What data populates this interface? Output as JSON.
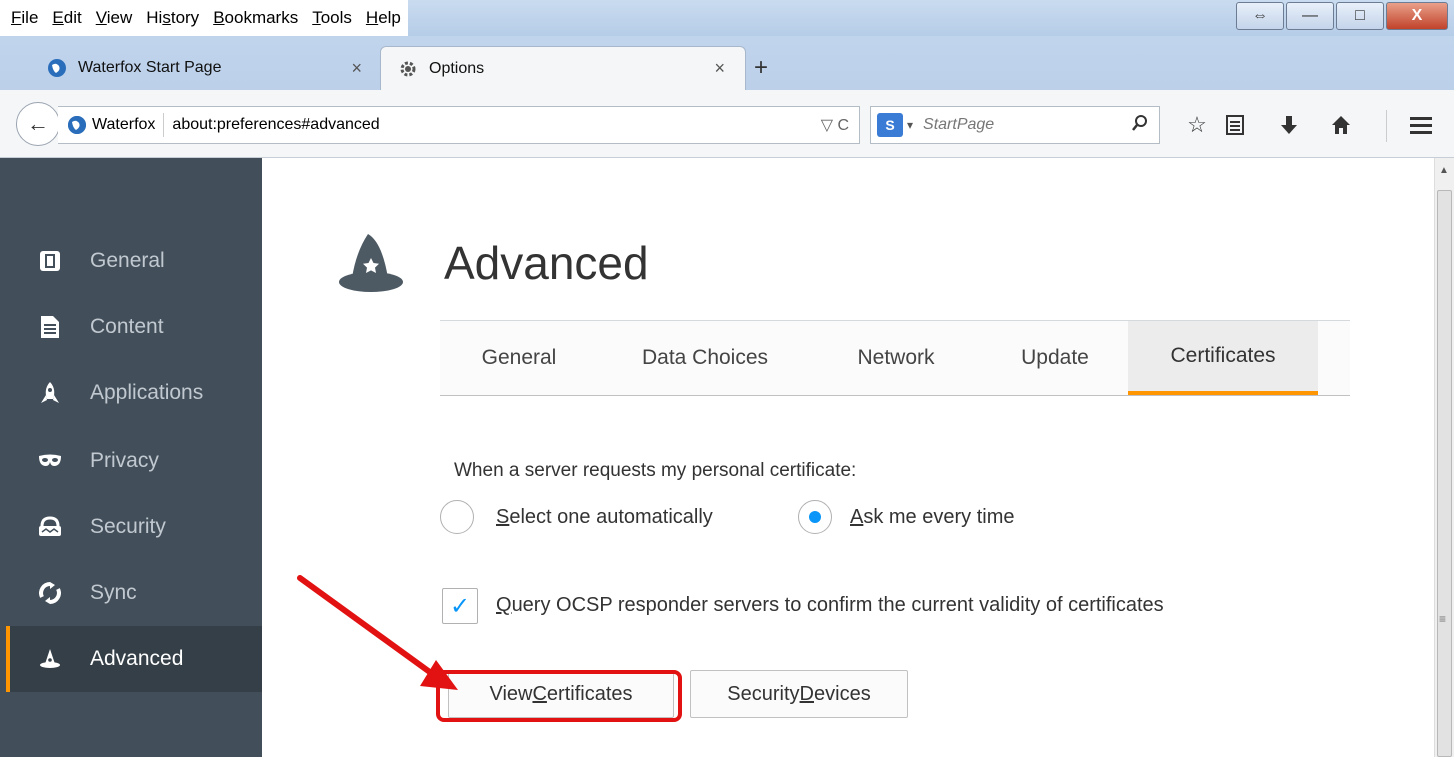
{
  "menu": [
    {
      "label": "File",
      "key": "F",
      "rest": "ile"
    },
    {
      "label": "Edit",
      "key": "E",
      "rest": "dit"
    },
    {
      "label": "View",
      "key": "V",
      "rest": "iew"
    },
    {
      "label": "History",
      "pre": "Hi",
      "key": "s",
      "rest": "tory"
    },
    {
      "label": "Bookmarks",
      "key": "B",
      "rest": "ookmarks"
    },
    {
      "label": "Tools",
      "key": "T",
      "rest": "ools"
    },
    {
      "label": "Help",
      "key": "H",
      "rest": "elp"
    }
  ],
  "window_buttons": {
    "minimize": "—",
    "maximize": "□",
    "close": "X"
  },
  "tabs": [
    {
      "title": "Waterfox Start Page",
      "close": "×",
      "selected": false
    },
    {
      "title": "Options",
      "close": "×",
      "selected": true
    }
  ],
  "new_tab_label": "+",
  "navbar": {
    "back": "←",
    "identity": "Waterfox",
    "url": "about:preferences#advanced",
    "url_icons": "▽ C",
    "search_placeholder": "StartPage",
    "search_engine_arrow": "▾",
    "icons": [
      "magnifier-icon",
      "star-icon",
      "reading-list-icon",
      "download-icon",
      "home-icon",
      "menu-icon"
    ]
  },
  "sidebar": {
    "items": [
      {
        "label": "General",
        "icon": "general-icon"
      },
      {
        "label": "Content",
        "icon": "content-icon"
      },
      {
        "label": "Applications",
        "icon": "applications-icon"
      },
      {
        "label": "Privacy",
        "icon": "privacy-mask-icon"
      },
      {
        "label": "Security",
        "icon": "security-icon"
      },
      {
        "label": "Sync",
        "icon": "sync-icon"
      },
      {
        "label": "Advanced",
        "icon": "wizard-hat-icon",
        "selected": true
      }
    ]
  },
  "page": {
    "title": "Advanced",
    "tabs": [
      {
        "label": "General"
      },
      {
        "label": "Data Choices"
      },
      {
        "label": "Network"
      },
      {
        "label": "Update"
      },
      {
        "label": "Certificates",
        "selected": true
      }
    ],
    "cert_request_label": "When a server requests my personal certificate:",
    "radio_auto": {
      "label": "Select one automatically",
      "key": "S",
      "rest": "elect one automatically",
      "checked": false
    },
    "radio_ask": {
      "label": "Ask me every time",
      "key": "A",
      "rest": "sk me every time",
      "checked": true
    },
    "ocsp": {
      "label": "Query OCSP responder servers to confirm the current validity of certificates",
      "key": "Q",
      "rest": "uery OCSP responder servers to confirm the current validity of certificates",
      "checked": true
    },
    "view_certificates": {
      "label": "View Certificates",
      "pre": "View ",
      "key": "C",
      "rest": "ertificates"
    },
    "security_devices": {
      "label": "Security Devices",
      "pre": "Security ",
      "key": "D",
      "rest": "evices"
    }
  },
  "colors": {
    "accent": "#ff9500",
    "sidebar_bg": "#424f5a",
    "annotation_red": "#e21212",
    "radio_blue": "#0996f8"
  }
}
